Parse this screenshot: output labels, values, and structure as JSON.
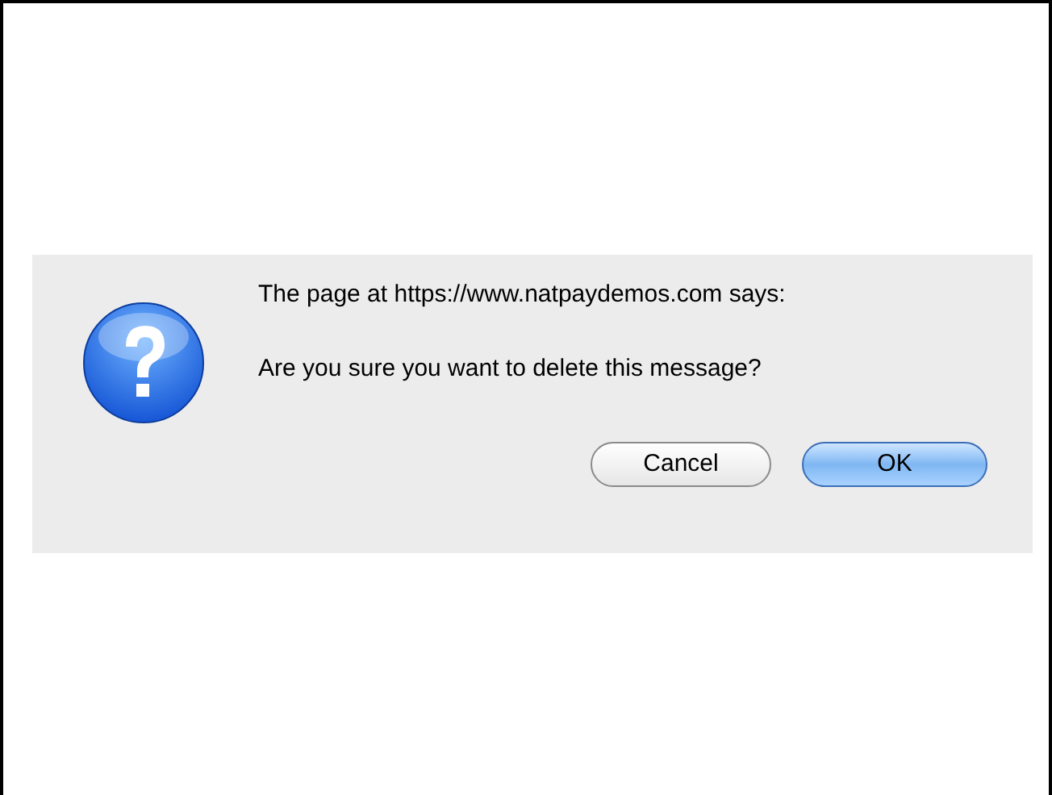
{
  "dialog": {
    "title": "The page at https://www.natpaydemos.com says:",
    "message": "Are you sure you want to delete this message?",
    "buttons": [
      {
        "label": "Cancel",
        "kind": "plain"
      },
      {
        "label": "OK",
        "kind": "default"
      }
    ]
  }
}
